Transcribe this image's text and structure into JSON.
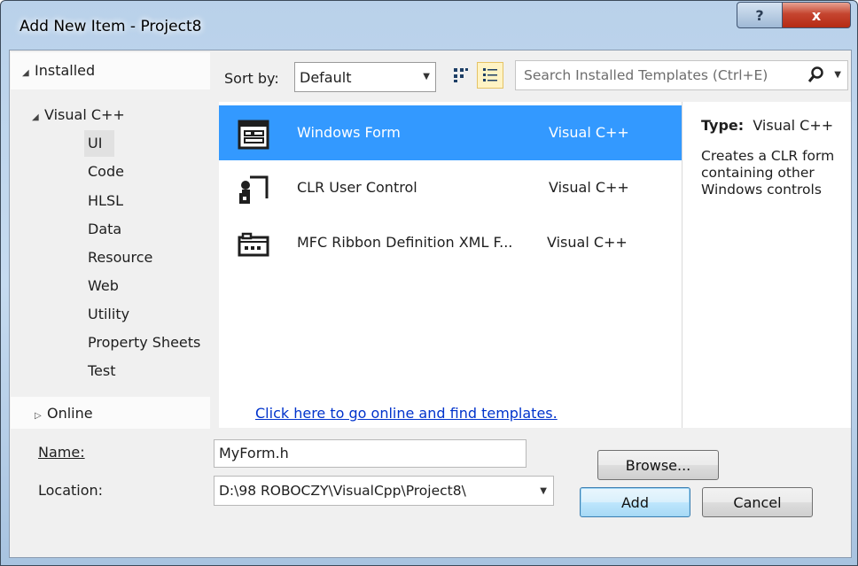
{
  "window": {
    "title": "Add New Item - Project8",
    "help_label": "?",
    "close_label": "x"
  },
  "tree": {
    "installed": "Installed",
    "visual_cpp": "Visual C++",
    "children": [
      "UI",
      "Code",
      "HLSL",
      "Data",
      "Resource",
      "Web",
      "Utility",
      "Property Sheets",
      "Test"
    ],
    "selected": "UI",
    "online": "Online"
  },
  "toolbar": {
    "sort_label": "Sort by:",
    "sort_value": "Default",
    "search_placeholder": "Search Installed Templates (Ctrl+E)"
  },
  "templates": [
    {
      "name": "Windows Form",
      "language": "Visual C++",
      "icon": "windows-form-icon",
      "selected": true
    },
    {
      "name": "CLR User Control",
      "language": "Visual C++",
      "icon": "user-control-icon",
      "selected": false
    },
    {
      "name": "MFC Ribbon Definition XML F...",
      "language": "Visual C++",
      "icon": "ribbon-icon",
      "selected": false
    }
  ],
  "online_link": "Click here to go online and find templates.",
  "details": {
    "type_label": "Type:",
    "type_value": "Visual C++",
    "description": "Creates a CLR form containing other Windows controls"
  },
  "form": {
    "name_label": "Name:",
    "name_value": "MyForm.h",
    "location_label": "Location:",
    "location_value": "D:\\98 ROBOCZY\\VisualCpp\\Project8\\"
  },
  "buttons": {
    "browse": "Browse...",
    "add": "Add",
    "cancel": "Cancel"
  },
  "colors": {
    "selection": "#3399ff",
    "link": "#0033cc",
    "dialog_bg": "#f0f0f0"
  }
}
